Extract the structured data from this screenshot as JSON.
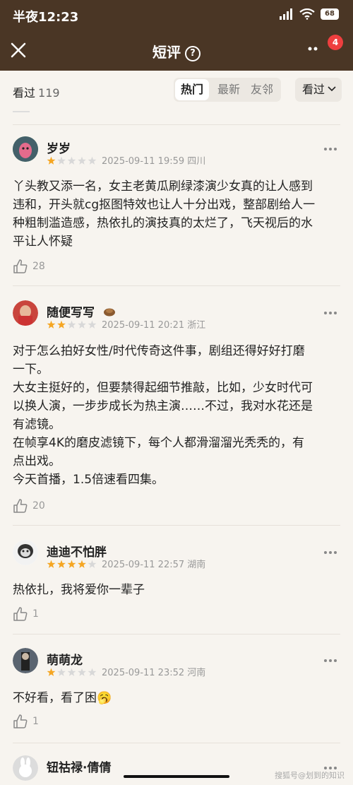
{
  "status": {
    "time": "半夜12:23",
    "battery": "68"
  },
  "header": {
    "title": "短评",
    "help": "?",
    "badge": "4"
  },
  "filter": {
    "seen_label": "看过",
    "seen_count": "119",
    "tabs": [
      "热门",
      "最新",
      "友邻"
    ],
    "sort_label": "看过"
  },
  "reviews": [
    {
      "name": "岁岁",
      "rating": 1,
      "time": "2025-09-11 19:59",
      "location": "四川",
      "lines": [
        "丫头教又添一名，女主老黄瓜刷绿漆演少女真的让人感到",
        "违和，开头就cg抠图特效也让人十分出戏，整部剧给人一",
        "种粗制滥造感，热依扎的演技真的太烂了，飞天视后的水",
        "平让人怀疑"
      ],
      "likes": "28"
    },
    {
      "name": "随便写写",
      "rating": 2,
      "time": "2025-09-11 20:21",
      "location": "浙江",
      "lines": [
        "对于怎么拍好女性/时代传奇这件事，剧组还得好好打磨",
        "一下。",
        "大女主挺好的，但要禁得起细节推敲，比如，少女时代可",
        "以换人演，一步步成长为热主演……不过，我对水花还是",
        "有滤镜。",
        "在帧享4K的磨皮滤镜下，每个人都滑溜溜光秃秃的，有",
        "点出戏。",
        "今天首播，1.5倍速看四集。"
      ],
      "likes": "20"
    },
    {
      "name": "迪迪不怕胖",
      "rating": 4,
      "time": "2025-09-11 22:57",
      "location": "湖南",
      "lines": [
        "热依扎，我将爱你一辈子"
      ],
      "likes": "1"
    },
    {
      "name": "萌萌龙",
      "rating": 1,
      "time": "2025-09-11 23:52",
      "location": "河南",
      "lines": [
        "不好看，看了困🥱"
      ],
      "likes": "1"
    },
    {
      "name": "钮祜禄·倩倩"
    }
  ],
  "watermark": "搜狐号@划到的知识",
  "colors": {
    "header_bg": "#4a3625",
    "star": "#f5a623",
    "badge": "#ee3f3f"
  }
}
